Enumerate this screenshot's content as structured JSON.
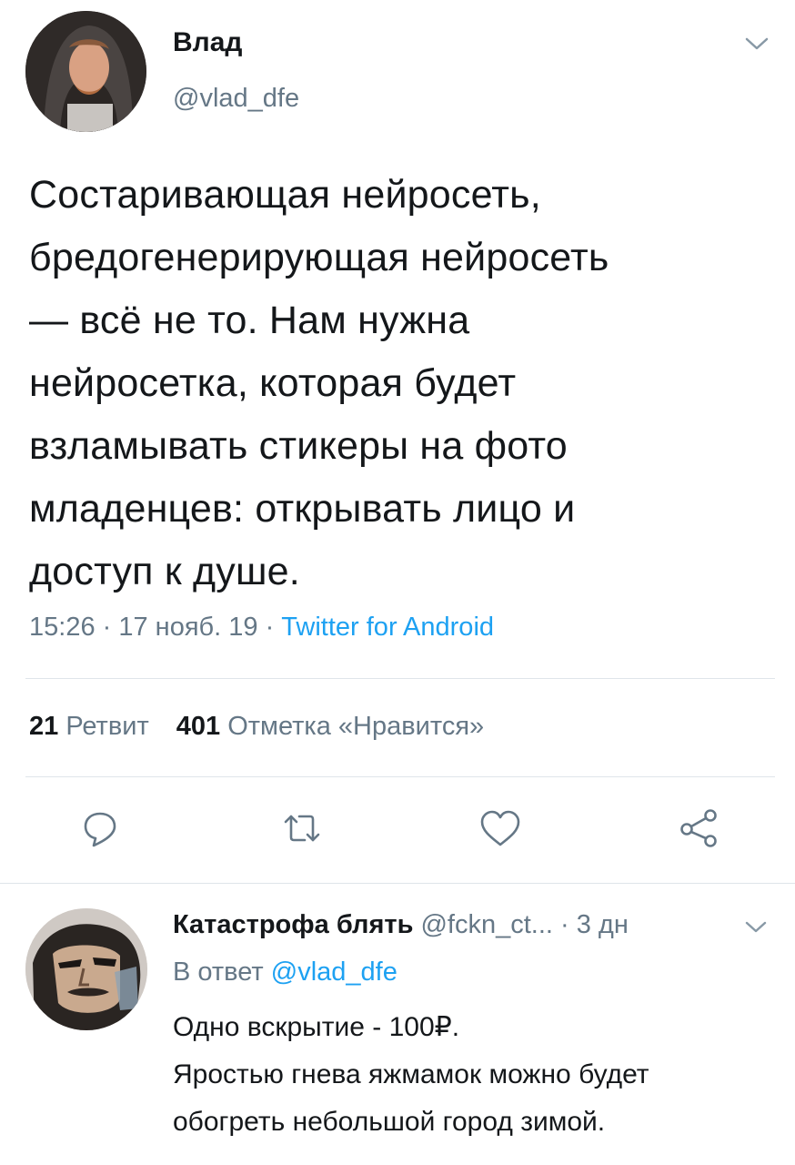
{
  "tweet": {
    "author": {
      "name": "Влад",
      "handle": "@vlad_dfe"
    },
    "text": "Состаривающая нейросеть,\nбредогенерирующая нейросеть\n— всё не то. Нам нужна\nнейросетка, которая будет\nвзламывать стикеры на фото\nмладенцев: открывать лицо и\nдоступ к душе.",
    "time": "15:26",
    "date": "17 нояб. 19",
    "separator": " · ",
    "source": "Twitter for Android",
    "stats": {
      "retweets_count": "21",
      "retweets_label": "Ретвит",
      "likes_count": "401",
      "likes_label": "Отметка «Нравится»"
    },
    "actions": [
      {
        "name": "reply",
        "icon": "reply-icon"
      },
      {
        "name": "retweet",
        "icon": "retweet-icon"
      },
      {
        "name": "like",
        "icon": "heart-icon"
      },
      {
        "name": "share",
        "icon": "share-icon"
      }
    ]
  },
  "reply": {
    "author_name": "Катастрофа блять",
    "author_handle": "@fckn_ct...",
    "time_ago": "3 дн",
    "in_reply_prefix": "В ответ",
    "in_reply_mention": "@vlad_dfe",
    "text": "Одно вскрытие - 100₽.\nЯростью гнева яжмамок можно будет\nобогреть небольшой город зимой."
  },
  "colors": {
    "text_primary": "#14171a",
    "text_secondary": "#657786",
    "accent": "#1da1f2",
    "divider": "#dfe5ea"
  }
}
